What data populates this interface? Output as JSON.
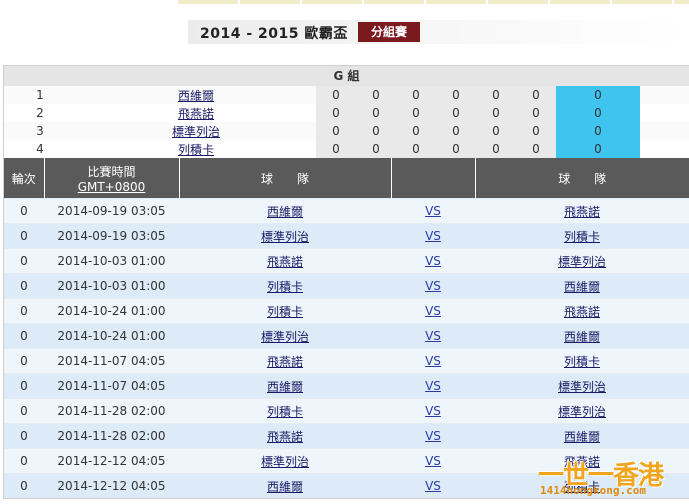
{
  "header": {
    "title": "2014 - 2015 歐霸盃",
    "badge": "分組賽"
  },
  "group": {
    "title": "G 組",
    "standings": [
      {
        "rank": "1",
        "team": "西維爾",
        "stats": [
          "0",
          "0",
          "0",
          "0",
          "0",
          "0"
        ],
        "points": "0"
      },
      {
        "rank": "2",
        "team": "飛燕諾",
        "stats": [
          "0",
          "0",
          "0",
          "0",
          "0",
          "0"
        ],
        "points": "0"
      },
      {
        "rank": "3",
        "team": "標準列治",
        "stats": [
          "0",
          "0",
          "0",
          "0",
          "0",
          "0"
        ],
        "points": "0"
      },
      {
        "rank": "4",
        "team": "列積卡",
        "stats": [
          "0",
          "0",
          "0",
          "0",
          "0",
          "0"
        ],
        "points": "0"
      }
    ]
  },
  "fixtures": {
    "headers": {
      "round": "輪次",
      "time": "比賽時間",
      "timezone": "GMT+0800",
      "team": "球　　隊",
      "team2": "球　　隊"
    },
    "rows": [
      {
        "round": "0",
        "datetime": "2014-09-19 03:05",
        "home": "西維爾",
        "vs": "VS",
        "away": "飛燕諾"
      },
      {
        "round": "0",
        "datetime": "2014-09-19 03:05",
        "home": "標準列治",
        "vs": "VS",
        "away": "列積卡"
      },
      {
        "round": "0",
        "datetime": "2014-10-03 01:00",
        "home": "飛燕諾",
        "vs": "VS",
        "away": "標準列治"
      },
      {
        "round": "0",
        "datetime": "2014-10-03 01:00",
        "home": "列積卡",
        "vs": "VS",
        "away": "西維爾"
      },
      {
        "round": "0",
        "datetime": "2014-10-24 01:00",
        "home": "列積卡",
        "vs": "VS",
        "away": "飛燕諾"
      },
      {
        "round": "0",
        "datetime": "2014-10-24 01:00",
        "home": "標準列治",
        "vs": "VS",
        "away": "西維爾"
      },
      {
        "round": "0",
        "datetime": "2014-11-07 04:05",
        "home": "飛燕諾",
        "vs": "VS",
        "away": "列積卡"
      },
      {
        "round": "0",
        "datetime": "2014-11-07 04:05",
        "home": "西維爾",
        "vs": "VS",
        "away": "標準列治"
      },
      {
        "round": "0",
        "datetime": "2014-11-28 02:00",
        "home": "列積卡",
        "vs": "VS",
        "away": "標準列治"
      },
      {
        "round": "0",
        "datetime": "2014-11-28 02:00",
        "home": "飛燕諾",
        "vs": "VS",
        "away": "西維爾"
      },
      {
        "round": "0",
        "datetime": "2014-12-12 04:05",
        "home": "標準列治",
        "vs": "VS",
        "away": "飛燕諾"
      },
      {
        "round": "0",
        "datetime": "2014-12-12 04:05",
        "home": "西維爾",
        "vs": "VS",
        "away": "列積卡"
      }
    ]
  },
  "watermark": {
    "line1": "一世一香港",
    "line2": "1414hongkong.com"
  }
}
